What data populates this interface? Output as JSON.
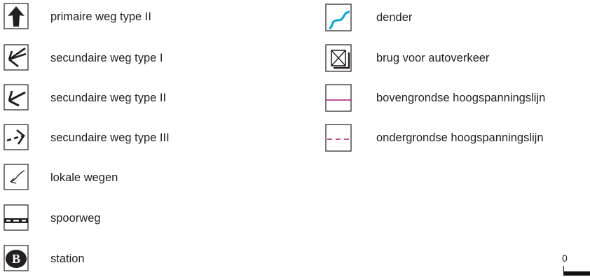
{
  "legend": {
    "left_items": [
      {
        "symbol": "primary-road-type-2-arrow-icon",
        "label": "primaire weg type II"
      },
      {
        "symbol": "secondary-road-type-1-double-arrow-icon",
        "label": "secundaire weg type I"
      },
      {
        "symbol": "secondary-road-type-2-arrow-icon",
        "label": "secundaire weg type II"
      },
      {
        "symbol": "secondary-road-type-3-dashed-arrow-icon",
        "label": "secundaire weg type III"
      },
      {
        "symbol": "local-road-thin-arrow-icon",
        "label": "lokale wegen"
      },
      {
        "symbol": "railway-dashed-line-icon",
        "label": "spoorweg"
      },
      {
        "symbol": "station-b-icon",
        "label": "station"
      }
    ],
    "right_items": [
      {
        "symbol": "river-dender-blue-line-icon",
        "label": "dender"
      },
      {
        "symbol": "car-bridge-crossed-square-icon",
        "label": "brug voor autoverkeer"
      },
      {
        "symbol": "overhead-power-line-solid-icon",
        "label": "bovengrondse hoogspanningslijn"
      },
      {
        "symbol": "underground-power-line-dashed-icon",
        "label": "ondergrondse hoogspanningslijn"
      }
    ]
  },
  "station_letter": "B",
  "scale_bar": {
    "zero_label": "0"
  },
  "colors": {
    "ink": "#231f20",
    "river": "#00a7df",
    "power_line": "#b2187f"
  }
}
